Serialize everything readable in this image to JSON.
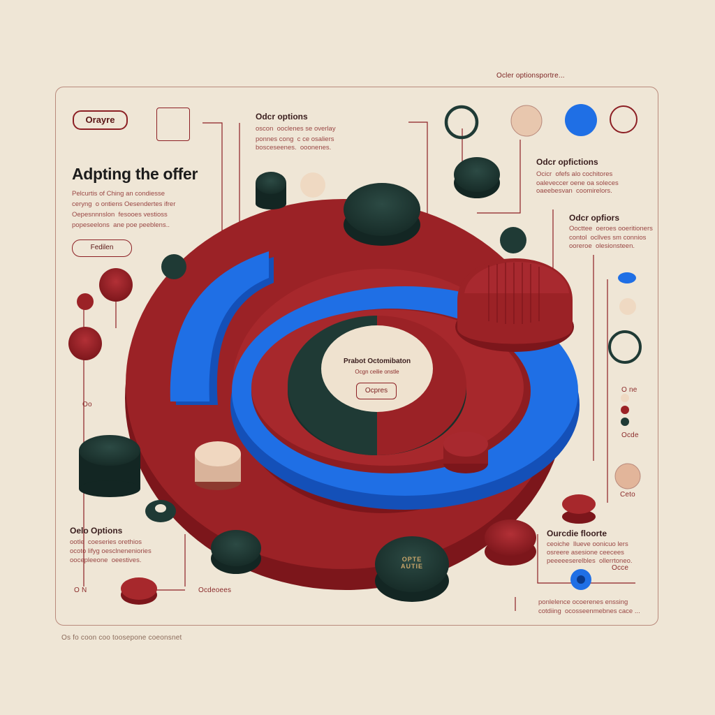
{
  "header": {
    "top_caption": "Ocler optionsportre..."
  },
  "left_panel": {
    "tag_label": "Orayre",
    "title": "Adpting the offer",
    "body_lines": [
      "Pelcurtis of Ching an condiesse",
      "ceryng  o ontiens Oesendertes ifrer",
      "Oepesnnnslon  fesooes vestioss",
      "popeseelons  ane poe peeblens.."
    ],
    "button_label": "Fedilen"
  },
  "top_options": {
    "heading": "Odcr options",
    "lines": [
      "oscon  ooclenes se overlay",
      "ponnes cong  c ce osaliers",
      "bosceseenes.  ooonenes."
    ]
  },
  "right_options_1": {
    "heading": "Odcr opfictions",
    "lines": [
      "Ocicr  ofefs alo cochitores",
      "oaleveccer oene oa soleces",
      "oaeebesvan  coomirelors."
    ]
  },
  "right_options_2": {
    "heading": "Odcr opfiors",
    "lines": [
      "Oocttee  oeroes ooeritioners",
      "contol  ocllves sm connios",
      "ooreroe  olesionsteen."
    ]
  },
  "center": {
    "title": "Prabot Octomibaton",
    "subtitle": "Ocgn ceilie onstle",
    "button_label": "Ocpres"
  },
  "right_small_labels": {
    "a": "O ne",
    "b": "Ocde",
    "c": "Ceto"
  },
  "left_small_labels": {
    "a": "Oo"
  },
  "bottom_left": {
    "heading": "Oelo Options",
    "lines": [
      "ootle  coeseries orethios",
      "ocoto lifyg oesclneneniories",
      "oocepleeone  oeestives."
    ],
    "label_left": "O N",
    "label_right": "Ocdeoees"
  },
  "bottom_right": {
    "heading": "Ourcdie floorte",
    "lines": [
      "ceoiche  llueve oonicuo lers",
      "osreere asesione ceecees",
      "peeeeeserelbles  ollerrtoneo."
    ],
    "label": "Occe",
    "lines2": [
      "ponlelence ocoerenes enssing",
      "cotdiing  ocosseenmebnes cace ..."
    ]
  },
  "badge_text": "OPTE AUTIE",
  "footer": "Os fo coon coo toosepone coeonsnet",
  "colors": {
    "background": "#efe6d6",
    "red": "#9b2226",
    "blue": "#1f6fe5",
    "dark": "#1f3a35",
    "beige": "#efd9c2"
  }
}
